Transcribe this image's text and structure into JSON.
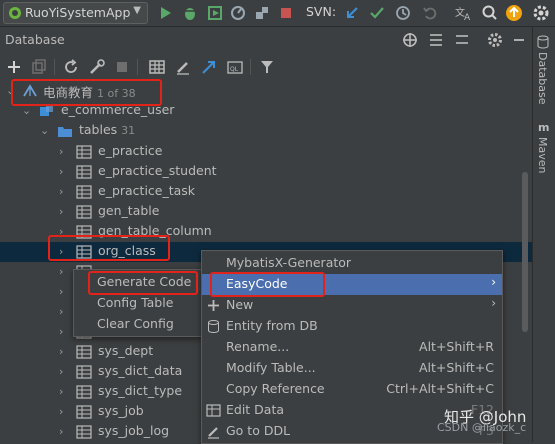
{
  "toolbar": {
    "run_config": "RuoYiSystemApp",
    "svn_label": "SVN:"
  },
  "panel": {
    "title": "Database"
  },
  "side_tabs": [
    "Database",
    "Maven"
  ],
  "tree": {
    "datasource": {
      "label": "电商教育",
      "badge": "1 of 38"
    },
    "schema": "e_commerce_user",
    "tables_folder": {
      "label": "tables",
      "count": "31"
    },
    "tables": [
      "e_practice",
      "e_practice_student",
      "e_practice_task",
      "gen_table",
      "gen_table_column",
      "org_class",
      "",
      "",
      "",
      "",
      "sys_dept",
      "sys_dict_data",
      "sys_dict_type",
      "sys_job",
      "sys_job_log"
    ]
  },
  "context_menu": {
    "items": [
      {
        "label": "MybatisX-Generator",
        "shortcut": ""
      },
      {
        "label": "EasyCode",
        "shortcut": "",
        "submenu": true
      },
      {
        "label": "New",
        "shortcut": "",
        "submenu": true
      },
      {
        "label": "Entity from DB",
        "shortcut": ""
      },
      {
        "label": "Rename...",
        "shortcut": "Alt+Shift+R"
      },
      {
        "label": "Modify Table...",
        "shortcut": "Alt+Shift+C"
      },
      {
        "label": "Copy Reference",
        "shortcut": "Ctrl+Alt+Shift+C"
      },
      {
        "label": "Edit Data",
        "shortcut": "F12"
      },
      {
        "label": "Go to DDL",
        "shortcut": "F3"
      }
    ]
  },
  "easycode_submenu": {
    "items": [
      "Generate Code",
      "Config Table",
      "Clear Config"
    ]
  },
  "watermark": {
    "text": "知乎 @John",
    "sub": "CSDN @liaozk_c"
  },
  "colors": {
    "selection": "#4b6eaf",
    "annotation": "#e2231a",
    "run_green": "#59a869"
  }
}
